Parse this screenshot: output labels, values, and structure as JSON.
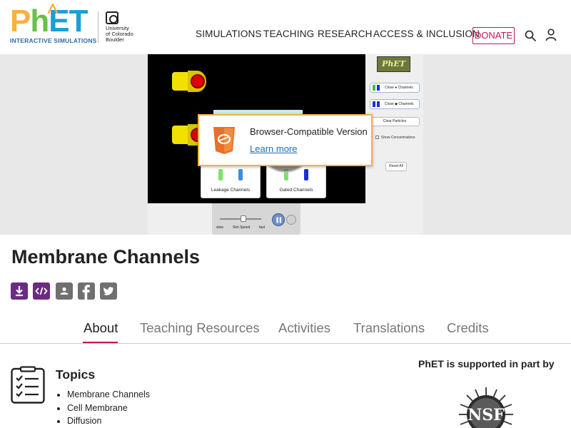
{
  "header": {
    "logo": {
      "letters": [
        "P",
        "h",
        "E",
        "T"
      ],
      "subtitle": "INTERACTIVE SIMULATIONS"
    },
    "partner": {
      "name": "University of Colorado Boulder",
      "lines": "University\nof Colorado\nBoulder"
    },
    "nav": {
      "simulations": "SIMULATIONS",
      "teaching": "TEACHING",
      "research": "RESEARCH",
      "access": "ACCESS & INCLUSION",
      "donate": "DONATE"
    },
    "icons": {
      "search": "search-icon",
      "user": "user-icon"
    }
  },
  "banner": {
    "sim_preview": {
      "logo_text": "PhET",
      "leakage_label": "Leakage Channels",
      "gated_label": "Gated Channels",
      "close_green": "Close ● Channels",
      "close_blue": "Close ◆ Channels",
      "clear_particles": "Clear Particles",
      "show_concentrations": "Show Concentrations",
      "reset_all": "Reset All",
      "speed_slow": "slow",
      "speed_label": "Sim Speed",
      "speed_fast": "fast"
    },
    "popup": {
      "title": "Browser-Compatible Version",
      "link": "Learn more",
      "icon": "html5-icon"
    },
    "play_icon": "play-icon"
  },
  "page": {
    "title": "Membrane Channels",
    "actions": [
      "download-icon",
      "embed-icon",
      "share-classroom-icon",
      "facebook-icon",
      "twitter-icon"
    ]
  },
  "tabs": [
    {
      "label": "About",
      "active": true
    },
    {
      "label": "Teaching Resources",
      "active": false
    },
    {
      "label": "Activities",
      "active": false
    },
    {
      "label": "Translations",
      "active": false
    },
    {
      "label": "Credits",
      "active": false
    }
  ],
  "topics": {
    "heading": "Topics",
    "items": [
      "Membrane Channels",
      "Cell Membrane",
      "Diffusion"
    ]
  },
  "support": {
    "text": "PhET is supported in part by",
    "logo_text": "NSF"
  },
  "colors": {
    "accent": "#c0185a",
    "purple": "#6b2a83",
    "link": "#1d6fb8",
    "popup_border": "#fbb041"
  }
}
